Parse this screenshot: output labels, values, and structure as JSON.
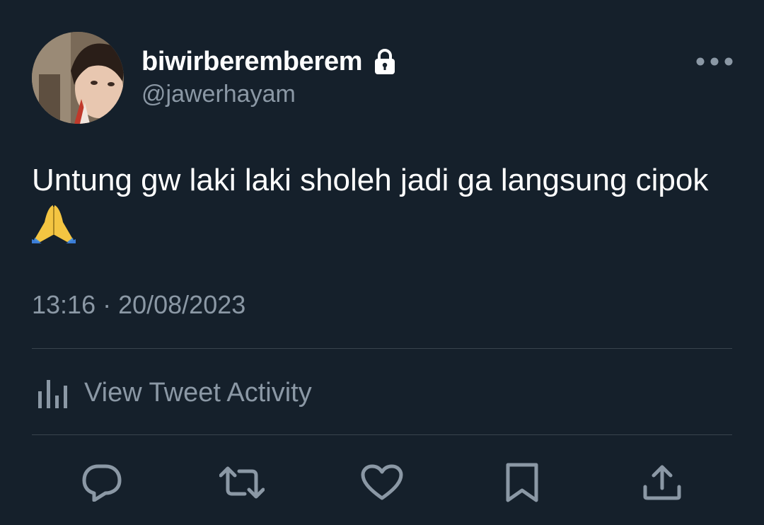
{
  "user": {
    "display_name": "biwirberemberem",
    "handle": "@jawerhayam",
    "avatar_icon": "profile-photo",
    "protected_icon": "lock-icon"
  },
  "tweet": {
    "text": "Untung gw laki laki sholeh jadi ga langsung cipok",
    "emoji": "folded-hands-emoji",
    "timestamp": "13:16 · 20/08/2023"
  },
  "activity": {
    "label": "View Tweet Activity",
    "icon": "analytics-icon"
  },
  "actions": [
    {
      "name": "reply",
      "icon": "reply-icon"
    },
    {
      "name": "retweet",
      "icon": "retweet-icon"
    },
    {
      "name": "like",
      "icon": "heart-icon"
    },
    {
      "name": "bookmark",
      "icon": "bookmark-icon"
    },
    {
      "name": "share",
      "icon": "share-icon"
    }
  ],
  "colors": {
    "background": "#15202b",
    "primary_text": "#ffffff",
    "secondary_text": "#8b98a5",
    "divider": "#38444d"
  }
}
